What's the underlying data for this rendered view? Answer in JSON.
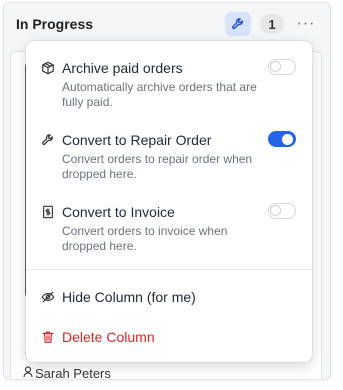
{
  "column": {
    "title": "In Progress",
    "count": "1",
    "more_label": "···"
  },
  "card": {
    "name": "Sarah Peters",
    "marks": [
      "I",
      "I",
      "("
    ]
  },
  "menu": {
    "items": [
      {
        "label": "Archive paid orders",
        "description": "Automatically archive orders that are fully paid.",
        "icon": "box-icon",
        "toggle": false
      },
      {
        "label": "Convert to Repair Order",
        "description": "Convert orders to repair order when dropped here.",
        "icon": "wrench-icon",
        "toggle": true
      },
      {
        "label": "Convert to Invoice",
        "description": "Convert orders to invoice when dropped here.",
        "icon": "invoice-icon",
        "toggle": false
      }
    ],
    "actions": [
      {
        "label": "Hide Column (for me)",
        "icon": "eye-off-icon"
      },
      {
        "label": "Delete Column",
        "icon": "trash-icon",
        "color": "#dc2626"
      }
    ]
  },
  "colors": {
    "accent": "#2563eb",
    "accent_soft": "#d7e3fb",
    "danger": "#dc2626"
  }
}
